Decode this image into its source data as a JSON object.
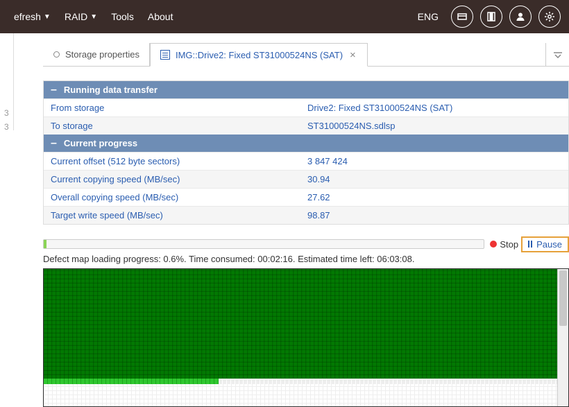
{
  "topbar": {
    "menu": [
      {
        "label": "efresh",
        "has_arrow": true
      },
      {
        "label": "RAID",
        "has_arrow": true
      },
      {
        "label": "Tools",
        "has_arrow": false
      },
      {
        "label": "About",
        "has_arrow": false
      }
    ],
    "lang": "ENG"
  },
  "sidebar_stub": {
    "a": "3",
    "b": "3"
  },
  "tabs": {
    "items": [
      {
        "label": "Storage properties",
        "active": false
      },
      {
        "label": "IMG::Drive2: Fixed ST31000524NS (SAT)",
        "active": true
      }
    ]
  },
  "sections": {
    "transfer": {
      "title": "Running data transfer",
      "rows": [
        {
          "label": "From storage",
          "value": "Drive2: Fixed ST31000524NS (SAT)"
        },
        {
          "label": "To storage",
          "value": "ST31000524NS.sdlsp"
        }
      ]
    },
    "progress": {
      "title": "Current progress",
      "rows": [
        {
          "label": "Current offset (512 byte sectors)",
          "value": "3 847 424"
        },
        {
          "label": "Current copying speed (MB/sec)",
          "value": "30.94"
        },
        {
          "label": "Overall copying speed (MB/sec)",
          "value": "27.62"
        },
        {
          "label": "Target write speed (MB/sec)",
          "value": "98.87"
        }
      ]
    }
  },
  "controls": {
    "stop": "Stop",
    "pause": "Pause"
  },
  "status_line": "Defect map loading progress: 0.6%. Time consumed: 00:02:16. Estimated time left: 06:03:08."
}
